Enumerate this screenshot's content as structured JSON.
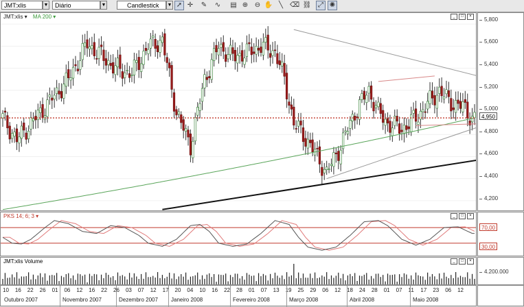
{
  "toolbar": {
    "symbol": "JMT:xlis",
    "period": "Diário",
    "chart_style": "Candlestick",
    "tools": [
      "pointer-icon",
      "crosshair-icon",
      "draw-icon",
      "wave-icon",
      "text-icon",
      "zoom-in-icon",
      "zoom-out-icon",
      "hand-icon",
      "line-icon",
      "eraser-icon",
      "link-icon",
      "fit-icon",
      "settings-icon"
    ]
  },
  "price_panel": {
    "symbol_label": "JMT:xlis ▾",
    "ma_label": "MA 200 ▾",
    "yticks": [
      "5,800",
      "5,600",
      "5,400",
      "5,200",
      "5,000",
      "4,800",
      "4,600",
      "4,400",
      "4,200"
    ],
    "last_price_tag": "4,950"
  },
  "stoch_panel": {
    "label": "PKS 14; 6; 3 ▾",
    "level_high": "70,00",
    "level_low": "30,00",
    "partial_tick": "30,00"
  },
  "volume_panel": {
    "label": "JMT:xlis Volume",
    "ytick": "4.200.000"
  },
  "x_axis": {
    "day_ticks": [
      "10",
      "16",
      "22",
      "26",
      "01",
      "06",
      "12",
      "16",
      "22",
      "26",
      "03",
      "07",
      "12",
      "17",
      "20",
      "04",
      "10",
      "16",
      "22",
      "28",
      "01",
      "07",
      "13",
      "19",
      "25",
      "29",
      "06",
      "12",
      "18",
      "24",
      "28",
      "01",
      "07",
      "11",
      "17",
      "23",
      "06",
      "12"
    ],
    "months": [
      "Outubro 2007",
      "Novembro 2007",
      "Dezembro 2007",
      "Janeiro 2008",
      "Fevereiro 2008",
      "Março 2008",
      "Abril 2008",
      "Maio 2008"
    ]
  },
  "chart_data": [
    {
      "type": "candlestick",
      "symbol": "JMT:xlis",
      "ylim": [
        4.1,
        5.9
      ],
      "y_ticks": [
        4.2,
        4.4,
        4.6,
        4.8,
        5.0,
        5.2,
        5.4,
        5.6,
        5.8
      ],
      "close_anchors": [
        [
          0,
          4.95
        ],
        [
          6,
          4.75
        ],
        [
          14,
          4.95
        ],
        [
          28,
          5.3
        ],
        [
          36,
          5.62
        ],
        [
          48,
          5.4
        ],
        [
          55,
          5.35
        ],
        [
          62,
          5.6
        ],
        [
          68,
          5.65
        ],
        [
          74,
          5.0
        ],
        [
          80,
          4.7
        ],
        [
          86,
          5.3
        ],
        [
          92,
          5.6
        ],
        [
          98,
          5.5
        ],
        [
          105,
          5.55
        ],
        [
          110,
          5.6
        ],
        [
          116,
          5.55
        ],
        [
          120,
          5.3
        ],
        [
          124,
          4.9
        ],
        [
          128,
          4.8
        ],
        [
          134,
          4.6
        ],
        [
          138,
          4.45
        ],
        [
          144,
          4.7
        ],
        [
          150,
          5.0
        ],
        [
          156,
          5.2
        ],
        [
          160,
          5.0
        ],
        [
          164,
          4.9
        ],
        [
          170,
          4.85
        ],
        [
          176,
          4.95
        ],
        [
          182,
          5.1
        ],
        [
          186,
          5.2
        ],
        [
          190,
          5.1
        ],
        [
          196,
          5.05
        ],
        [
          200,
          4.95
        ]
      ],
      "moving_average": {
        "name": "MA 200",
        "start": 4.12,
        "end": 4.95
      },
      "last_price": 4.95,
      "trendlines": [
        {
          "color": "#999999",
          "from": [
            124,
            5.75
          ],
          "to": [
            236,
            5.15
          ]
        },
        {
          "color": "#111111",
          "from": [
            68,
            4.12
          ],
          "to": [
            236,
            4.68
          ]
        },
        {
          "color": "#999999",
          "from": [
            138,
            4.4
          ],
          "to": [
            232,
            5.08
          ]
        },
        {
          "color": "#d88888",
          "from": [
            160,
            5.28
          ],
          "to": [
            184,
            5.33
          ]
        },
        {
          "color": "#d88888",
          "from": [
            176,
            4.88
          ],
          "to": [
            208,
            4.9
          ]
        }
      ]
    },
    {
      "type": "line",
      "name": "PKS 14; 6; 3",
      "ylim": [
        0,
        100
      ],
      "levels": [
        70,
        30
      ],
      "k_anchors": [
        [
          0,
          45
        ],
        [
          4,
          30
        ],
        [
          8,
          28
        ],
        [
          12,
          40
        ],
        [
          18,
          70
        ],
        [
          22,
          88
        ],
        [
          28,
          80
        ],
        [
          34,
          60
        ],
        [
          40,
          55
        ],
        [
          46,
          75
        ],
        [
          52,
          70
        ],
        [
          58,
          50
        ],
        [
          62,
          30
        ],
        [
          68,
          22
        ],
        [
          74,
          40
        ],
        [
          80,
          75
        ],
        [
          84,
          78
        ],
        [
          88,
          60
        ],
        [
          92,
          30
        ],
        [
          98,
          22
        ],
        [
          104,
          28
        ],
        [
          110,
          55
        ],
        [
          116,
          88
        ],
        [
          122,
          78
        ],
        [
          126,
          45
        ],
        [
          130,
          20
        ],
        [
          136,
          12
        ],
        [
          142,
          20
        ],
        [
          148,
          50
        ],
        [
          154,
          85
        ],
        [
          160,
          88
        ],
        [
          164,
          75
        ],
        [
          170,
          40
        ],
        [
          176,
          25
        ],
        [
          182,
          40
        ],
        [
          188,
          70
        ],
        [
          194,
          72
        ],
        [
          200,
          55
        ]
      ]
    },
    {
      "type": "bar",
      "name": "JMT:xlis Volume",
      "ytick": 4200000
    }
  ]
}
